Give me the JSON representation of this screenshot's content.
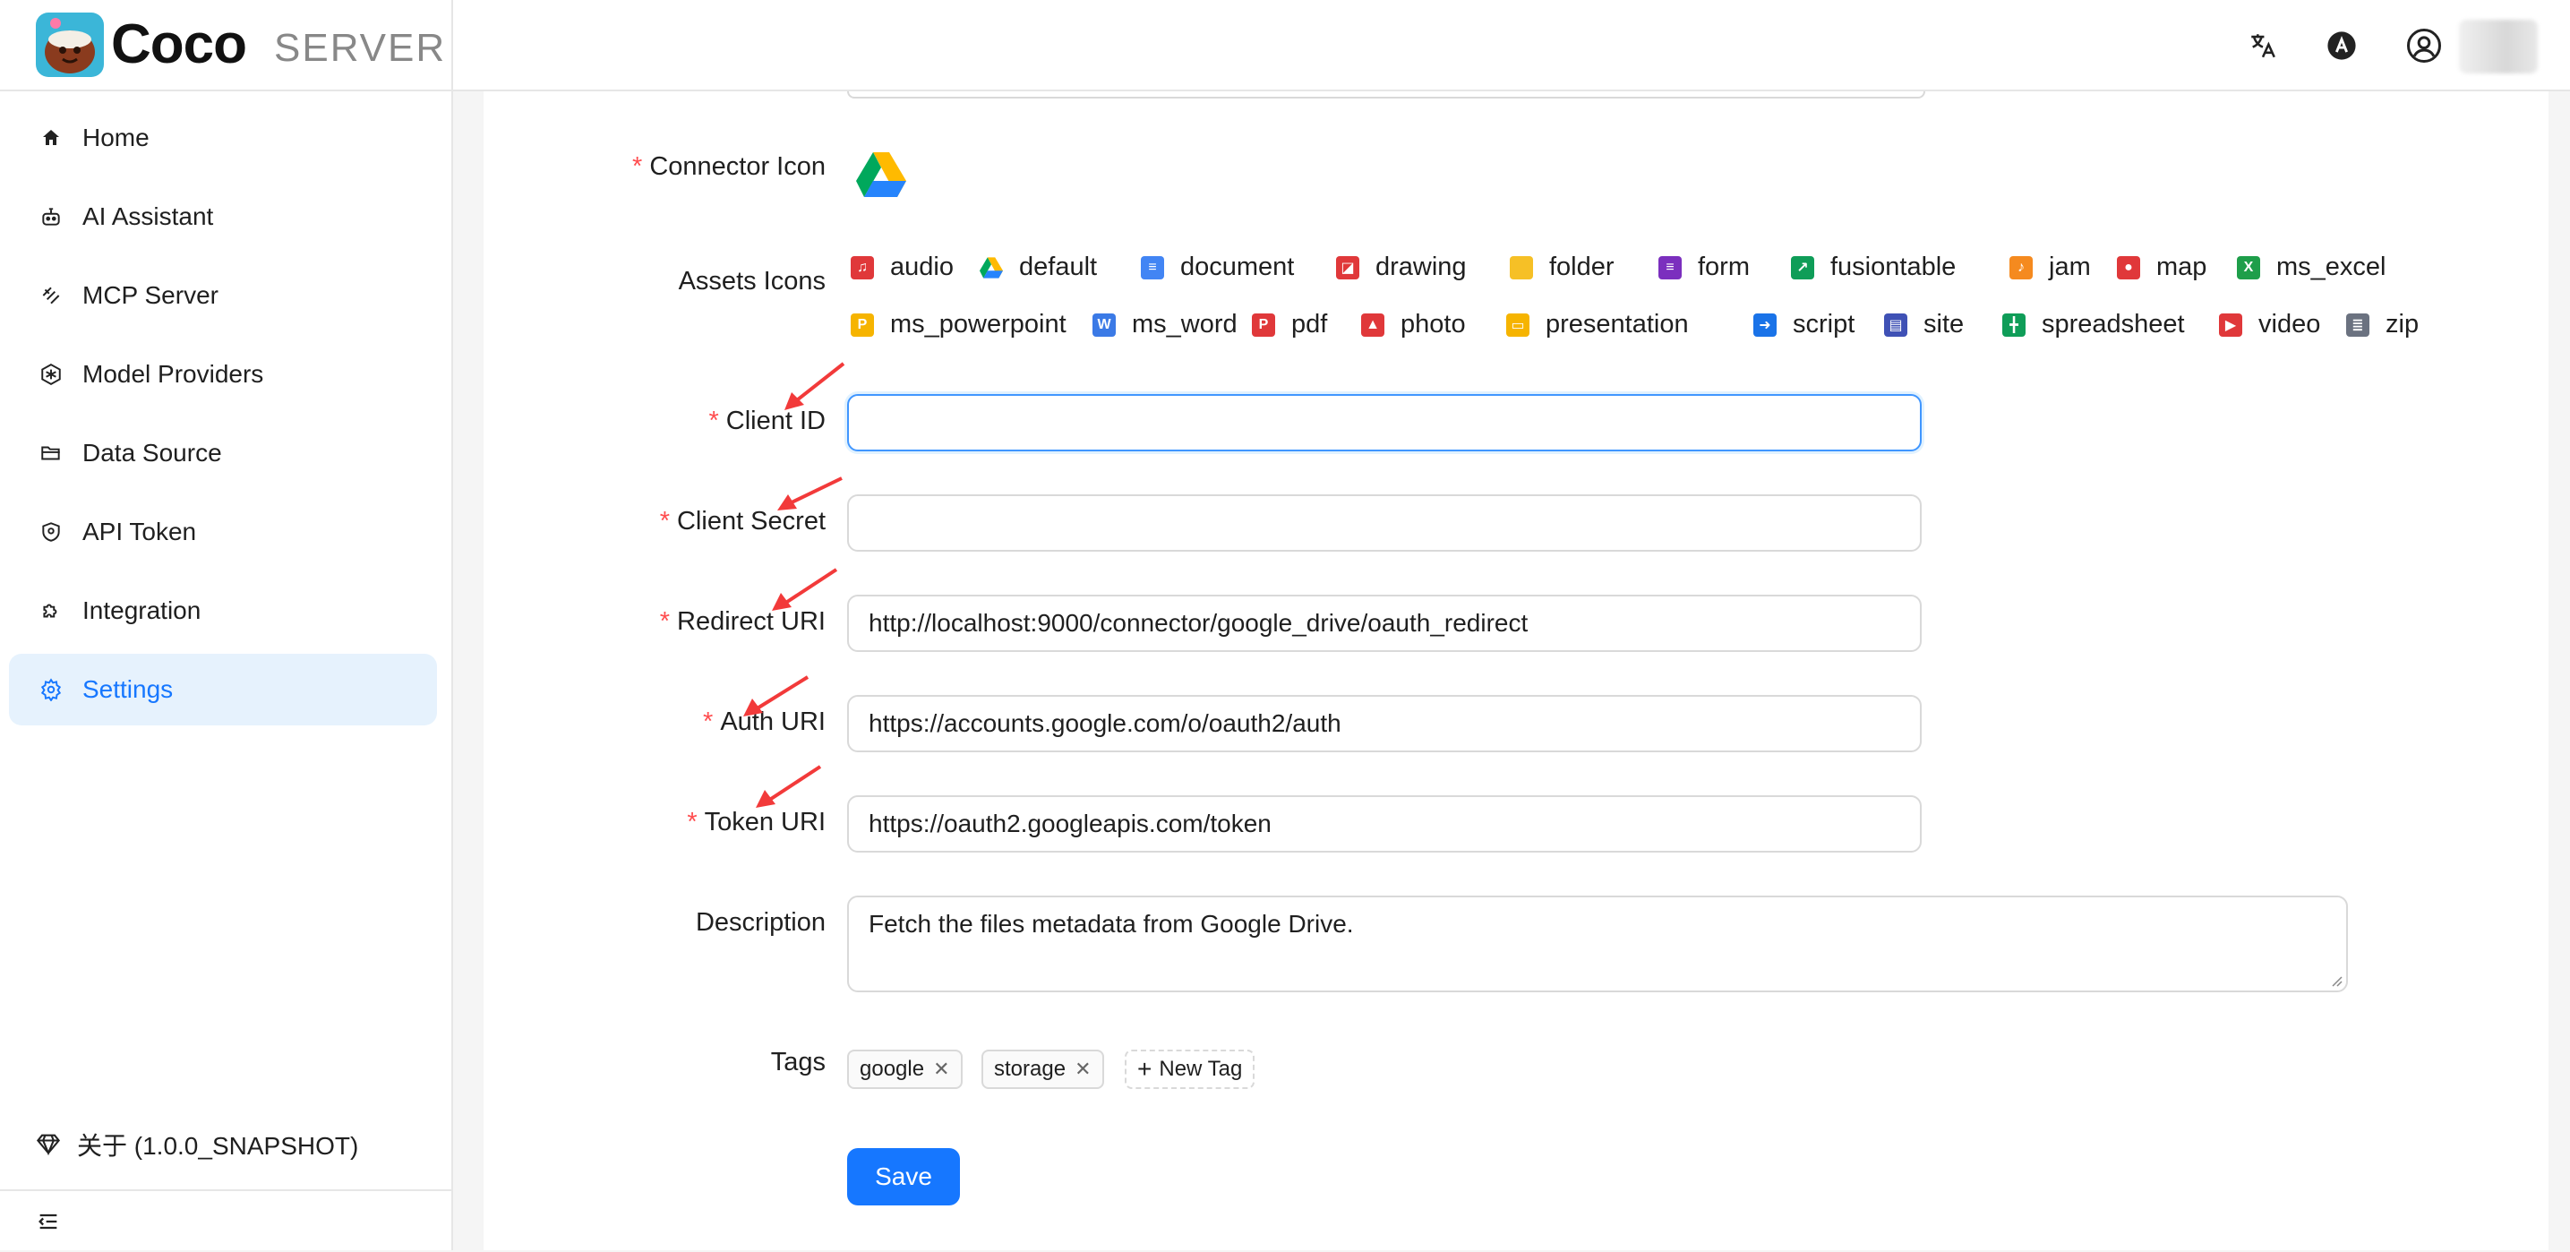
{
  "app": {
    "name": "Coco",
    "subtitle": "SERVER"
  },
  "header_icons": [
    "translate-icon",
    "theme-icon",
    "user-account-icon"
  ],
  "sidebar": {
    "items": [
      {
        "label": "Home",
        "icon": "home-icon"
      },
      {
        "label": "AI Assistant",
        "icon": "robot-icon"
      },
      {
        "label": "MCP Server",
        "icon": "mcp-icon"
      },
      {
        "label": "Model Providers",
        "icon": "model-icon"
      },
      {
        "label": "Data Source",
        "icon": "folder-open-icon"
      },
      {
        "label": "API Token",
        "icon": "shield-icon"
      },
      {
        "label": "Integration",
        "icon": "puzzle-icon"
      },
      {
        "label": "Settings",
        "icon": "gear-icon",
        "active": true
      }
    ],
    "about": "关于 (1.0.0_SNAPSHOT)"
  },
  "form": {
    "connector_icon_label": "Connector Icon",
    "assets_icons_label": "Assets Icons",
    "assets": [
      {
        "name": "audio",
        "color": "#e0383a"
      },
      {
        "name": "default",
        "color": "#34a853"
      },
      {
        "name": "document",
        "color": "#4285f4"
      },
      {
        "name": "drawing",
        "color": "#e0383a"
      },
      {
        "name": "folder",
        "color": "#f6c026"
      },
      {
        "name": "form",
        "color": "#7b2fbe"
      },
      {
        "name": "fusiontable",
        "color": "#0f9d58"
      },
      {
        "name": "jam",
        "color": "#f58a1f"
      },
      {
        "name": "map",
        "color": "#e0383a"
      },
      {
        "name": "ms_excel",
        "color": "#1e9e4a"
      },
      {
        "name": "ms_powerpoint",
        "color": "#f6b400"
      },
      {
        "name": "ms_word",
        "color": "#3b7ae6"
      },
      {
        "name": "pdf",
        "color": "#e0383a"
      },
      {
        "name": "photo",
        "color": "#e0383a"
      },
      {
        "name": "presentation",
        "color": "#f6b400"
      },
      {
        "name": "script",
        "color": "#1a73e8"
      },
      {
        "name": "site",
        "color": "#3f51b5"
      },
      {
        "name": "spreadsheet",
        "color": "#0f9d58"
      },
      {
        "name": "video",
        "color": "#e0383a"
      },
      {
        "name": "zip",
        "color": "#6b7280"
      }
    ],
    "client_id": {
      "label": "Client ID",
      "value": ""
    },
    "client_secret": {
      "label": "Client Secret",
      "value": ""
    },
    "redirect_uri": {
      "label": "Redirect URI",
      "value": "http://localhost:9000/connector/google_drive/oauth_redirect"
    },
    "auth_uri": {
      "label": "Auth URI",
      "value": "https://accounts.google.com/o/oauth2/auth"
    },
    "token_uri": {
      "label": "Token URI",
      "value": "https://oauth2.googleapis.com/token"
    },
    "description": {
      "label": "Description",
      "value": "Fetch the files metadata from Google Drive."
    },
    "tags_label": "Tags",
    "tags": [
      "google",
      "storage"
    ],
    "new_tag": "New Tag",
    "save": "Save",
    "required_mark": "*"
  },
  "colors": {
    "accent": "#1677ff",
    "required": "#ff4d4f",
    "annotation_arrow": "#f23a3a",
    "active_bg": "#e6f2fd"
  }
}
